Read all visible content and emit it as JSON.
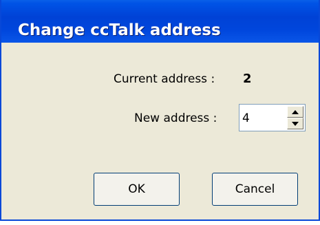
{
  "window": {
    "title": "Change ccTalk address"
  },
  "current": {
    "label": "Current address :",
    "value": "2"
  },
  "new_address": {
    "label": "New address :",
    "value": "4"
  },
  "buttons": {
    "ok": "OK",
    "cancel": "Cancel"
  },
  "icons": {
    "spin_up": "triangle-up-icon",
    "spin_down": "triangle-down-icon"
  },
  "colors": {
    "titlebar": "#0046dc",
    "dialog_bg": "#ece9d8",
    "button_border": "#003c74"
  }
}
